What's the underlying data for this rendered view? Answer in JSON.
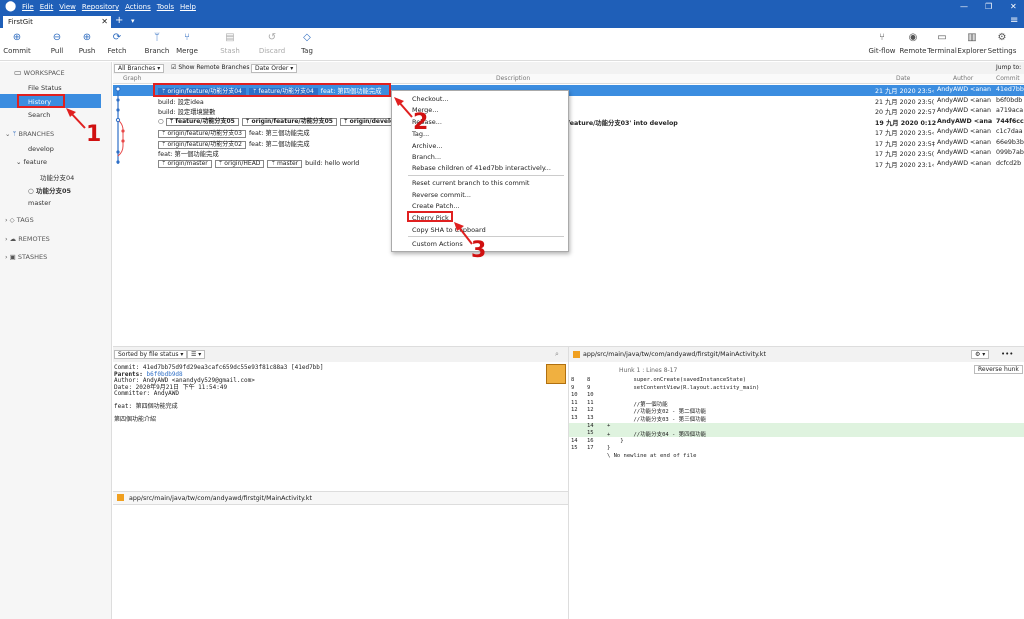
{
  "app": {
    "logo": "sourcetree-icon",
    "window_controls": [
      "—",
      "❐",
      "✕"
    ]
  },
  "menu": [
    "File",
    "Edit",
    "View",
    "Repository",
    "Actions",
    "Tools",
    "Help"
  ],
  "tab": {
    "label": "FirstGit",
    "close": "✕",
    "add": "+",
    "dropdown": "▾",
    "hamburger": "≡"
  },
  "toolbar": {
    "left": [
      {
        "label": "Commit",
        "icon": "plus-circle-icon"
      },
      {
        "label": "Pull",
        "icon": "pull-arrow-icon"
      },
      {
        "label": "Push",
        "icon": "push-arrow-icon"
      },
      {
        "label": "Fetch",
        "icon": "fetch-arrow-icon"
      },
      {
        "label": "Branch",
        "icon": "branch-icon"
      },
      {
        "label": "Merge",
        "icon": "merge-icon"
      },
      {
        "label": "Stash",
        "icon": "stash-icon"
      },
      {
        "label": "Discard",
        "icon": "discard-icon"
      },
      {
        "label": "Tag",
        "icon": "tag-icon"
      }
    ],
    "right": [
      {
        "label": "Git-flow",
        "icon": "gitflow-icon"
      },
      {
        "label": "Remote",
        "icon": "remote-icon"
      },
      {
        "label": "Terminal",
        "icon": "terminal-icon"
      },
      {
        "label": "Explorer",
        "icon": "folder-icon"
      },
      {
        "label": "Settings",
        "icon": "gear-icon"
      }
    ]
  },
  "sidebar": {
    "workspace": "WORKSPACE",
    "file_status": "File Status",
    "history": "History",
    "search": "Search",
    "branches": "BRANCHES",
    "develop": "develop",
    "feature": "feature",
    "f04": "功能分支04",
    "f05": "功能分支05",
    "master": "master",
    "tags": "TAGS",
    "remotes": "REMOTES",
    "stashes": "STASHES"
  },
  "graph_toolbar": {
    "all_branches": "All Branches ▾",
    "show_remote": "Show Remote Branches",
    "date_order": "Date Order ▾",
    "jump_to": "Jump to:"
  },
  "columns": {
    "graph": "Graph",
    "description": "Description",
    "date": "Date",
    "author": "Author",
    "commit": "Commit"
  },
  "rows": [
    {
      "badges": [
        {
          "t": "origin/feature/功能分支04",
          "c": "blue"
        },
        {
          "t": "feature/功能分支04",
          "c": "blue"
        }
      ],
      "desc": "feat: 第四個功能完成",
      "date": "21 九月 2020 23:5‹",
      "author": "AndyAWD <anan",
      "commit": "41ed7bb"
    },
    {
      "badges": [],
      "desc": "build: 設定idea",
      "date": "21 九月 2020 23:5(",
      "author": "AndyAWD <anan",
      "commit": "b6f0bdb"
    },
    {
      "badges": [],
      "desc": "build: 設定環境變數",
      "date": "20 九月 2020 22:57",
      "author": "AndyAWD <anan",
      "commit": "a719aca"
    },
    {
      "badges": [
        {
          "t": "feature/功能分支05",
          "c": "white"
        },
        {
          "t": "origin/feature/功能分支05",
          "c": "white"
        },
        {
          "t": "origin/develop",
          "c": "white"
        }
      ],
      "desc": "feature/功能分支03' into develop",
      "date": "19 九月 2020 0:12",
      "author": "AndyAWD <ana",
      "commit": "744f6cc"
    },
    {
      "badges": [
        {
          "t": "origin/feature/功能分支03",
          "c": "white"
        }
      ],
      "desc": "feat: 第三個功能完成",
      "date": "17 九月 2020 23:5‹",
      "author": "AndyAWD <anan",
      "commit": "c1c7daa"
    },
    {
      "badges": [
        {
          "t": "origin/feature/功能分支02",
          "c": "white"
        }
      ],
      "desc": "feat: 第二個功能完成",
      "date": "17 九月 2020 23:5‡",
      "author": "AndyAWD <anan",
      "commit": "66e9b3b"
    },
    {
      "badges": [],
      "desc": "feat: 第一個功能完成",
      "date": "17 九月 2020 23:5(",
      "author": "AndyAWD <anan",
      "commit": "099b7ab"
    },
    {
      "badges": [
        {
          "t": "origin/master",
          "c": "white"
        },
        {
          "t": "origin/HEAD",
          "c": "white"
        },
        {
          "t": "master",
          "c": "white"
        }
      ],
      "desc": "build: hello world",
      "date": "17 九月 2020 23:1‹",
      "author": "AndyAWD <anan",
      "commit": "dcfcd2b"
    }
  ],
  "context_menu": [
    "Checkout...",
    "Merge...",
    "Rebase...",
    "Tag...",
    "Archive...",
    "Branch...",
    "Rebase children of 41ed7bb interactively...",
    "Reset current branch to this commit",
    "Reverse commit...",
    "Create Patch...",
    "Cherry Pick",
    "Copy SHA to Clipboard",
    "Custom Actions"
  ],
  "annotations": [
    "1",
    "2",
    "3"
  ],
  "details": {
    "sort": "Sorted by file status ▾",
    "view": "☰ ▾",
    "commit": "Commit: 41ed7bb75d9fd29ea3cafc659dc55e93f81c88a3 [41ed7bb]",
    "parents_label": "Parents:",
    "parents": "b6f0bdb9d8",
    "author": "Author: AndyAWD <anandydy529@gmail.com>",
    "date": "Date: 2020年9月21日 下午 11:54:49",
    "committer": "Committer: AndyAWD",
    "msg1": "feat: 第四個功能完成",
    "msg2": "第四個功能介紹",
    "file": "app/src/main/java/tw/com/andyawd/firstgit/MainActivity.kt"
  },
  "diff": {
    "file": "app/src/main/java/tw/com/andyawd/firstgit/MainActivity.kt",
    "hunk": "Hunk 1 : Lines 8-17",
    "reverse": "Reverse hunk",
    "more": "•••",
    "lines": [
      {
        "o": "8",
        "n": "8",
        "t": "        super.onCreate(savedInstanceState)",
        "a": false
      },
      {
        "o": "9",
        "n": "9",
        "t": "        setContentView(R.layout.activity_main)",
        "a": false
      },
      {
        "o": "10",
        "n": "10",
        "t": "",
        "a": false
      },
      {
        "o": "11",
        "n": "11",
        "t": "        //第一個功能",
        "a": false
      },
      {
        "o": "12",
        "n": "12",
        "t": "        //功能分支02 - 第二個功能",
        "a": false
      },
      {
        "o": "13",
        "n": "13",
        "t": "        //功能分支03 - 第三個功能",
        "a": false
      },
      {
        "o": "",
        "n": "14",
        "t": "+",
        "a": true
      },
      {
        "o": "",
        "n": "15",
        "t": "+       //功能分支04 - 第四個功能",
        "a": true
      },
      {
        "o": "14",
        "n": "16",
        "t": "    }",
        "a": false
      },
      {
        "o": "15",
        "n": "17",
        "t": "}",
        "a": false
      },
      {
        "o": "",
        "n": "",
        "t": "\\ No newline at end of file",
        "a": false
      }
    ]
  }
}
